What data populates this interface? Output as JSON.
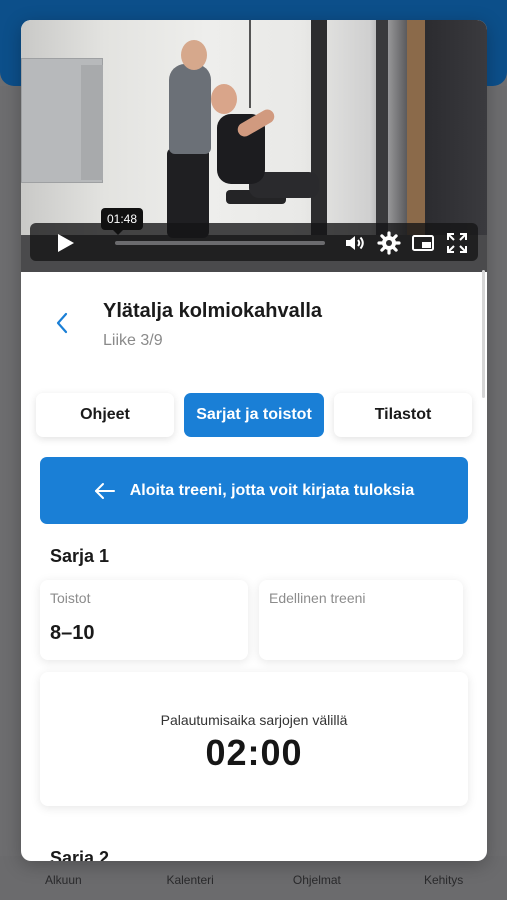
{
  "video": {
    "current_time": "01:48",
    "progress": 0.0
  },
  "exercise": {
    "title": "Ylätalja kolmiokahvalla",
    "subtitle": "Liike 3/9"
  },
  "tabs": [
    {
      "label": "Ohjeet",
      "active": false
    },
    {
      "label": "Sarjat ja toistot",
      "active": true
    },
    {
      "label": "Tilastot",
      "active": false
    }
  ],
  "banner": {
    "text": "Aloita treeni, jotta voit kirjata tuloksia"
  },
  "sets": [
    {
      "title": "Sarja 1",
      "reps_label": "Toistot",
      "reps_value": "8–10",
      "previous_label": "Edellinen treeni",
      "previous_value": "",
      "rest_label": "Palautumisaika sarjojen välillä",
      "rest_value": "02:00"
    },
    {
      "title": "Sarja 2"
    }
  ],
  "background_tabbar": [
    "Alkuun",
    "Kalenteri",
    "Ohjelmat",
    "Kehitys"
  ],
  "colors": {
    "accent": "#1a7fd6",
    "header_bg": "#0c4f8a"
  }
}
